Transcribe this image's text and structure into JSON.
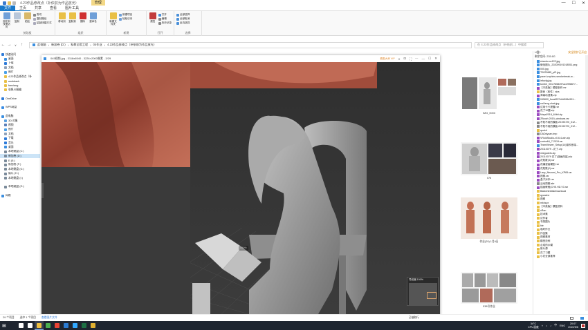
{
  "window": {
    "title": "4.23作品修改点（补依前为作品放光）",
    "manage_tab": "管理",
    "minimize_icon": "minimize-icon",
    "maximize_icon": "maximize-icon",
    "close_icon": "close-icon"
  },
  "ribbon_tabs": [
    "文件",
    "主页",
    "共享",
    "查看",
    "图片工具"
  ],
  "ribbon": {
    "clipboard": {
      "name": "剪贴板",
      "pin": "固定到快速访问",
      "copy": "复制",
      "paste": "粘贴",
      "cut": "剪切",
      "copy_path": "复制路径",
      "paste_shortcut": "粘贴快捷方式"
    },
    "organize": {
      "name": "组织",
      "move_to": "移动到",
      "copy_to": "复制到",
      "delete": "删除",
      "rename": "重命名"
    },
    "new": {
      "name": "新建",
      "new_folder": "新建文件夹",
      "new_item": "新建项目",
      "easy_access": "轻松访问"
    },
    "open": {
      "name": "打开",
      "properties": "属性",
      "open": "打开",
      "edit": "编辑",
      "history": "历史记录"
    },
    "select": {
      "name": "选择",
      "select_all": "全部选择",
      "select_none": "全部取消",
      "invert": "反向选择"
    }
  },
  "address": {
    "back_icon": "back-arrow-icon",
    "forward_icon": "forward-arrow-icon",
    "recent_icon": "chevron-down-icon",
    "up_icon": "up-arrow-icon",
    "crumbs": [
      "此电脑",
      "新加卷 (D:)",
      "私教全套工程",
      "04作业",
      "4.23作品修改点（补依前为作品放光）"
    ],
    "search_placeholder": "在 4.23作品修改点（补依前...）中搜索"
  },
  "sidebar": {
    "items": [
      {
        "label": "快速访问",
        "icon": "star-icon",
        "color": "#2f7bd8"
      },
      {
        "label": "桌面",
        "icon": "desktop-icon",
        "color": "#3b8fe0"
      },
      {
        "label": "下载",
        "icon": "download-icon",
        "color": "#2f7bd8"
      },
      {
        "label": "文档",
        "icon": "document-icon",
        "color": "#8da0b8"
      },
      {
        "label": "图片",
        "icon": "picture-icon",
        "color": "#4aa0e8"
      },
      {
        "label": "4.23作品修改点（补",
        "icon": "folder-icon",
        "color": "#e9c046"
      },
      {
        "label": "workback",
        "icon": "folder-icon",
        "color": "#e9c046"
      },
      {
        "label": "fanxiang",
        "icon": "folder-icon",
        "color": "#e9c046"
      },
      {
        "label": "张帆卡图编",
        "icon": "folder-icon",
        "color": "#e9c046"
      },
      {
        "label": "",
        "icon": "",
        "color": ""
      },
      {
        "label": "OneDrive",
        "icon": "cloud-icon",
        "color": "#2f7bd8"
      },
      {
        "label": "",
        "icon": "",
        "color": ""
      },
      {
        "label": "WPS网盘",
        "icon": "cloud-icon",
        "color": "#3a8ee6"
      },
      {
        "label": "",
        "icon": "",
        "color": ""
      },
      {
        "label": "此电脑",
        "icon": "computer-icon",
        "color": "#3b8fe0"
      },
      {
        "label": "3D 对象",
        "icon": "cube-icon",
        "color": "#5aa0e0"
      },
      {
        "label": "视频",
        "icon": "video-icon",
        "color": "#5a7fb8"
      },
      {
        "label": "图片",
        "icon": "picture-icon",
        "color": "#4aa0e8"
      },
      {
        "label": "文档",
        "icon": "document-icon",
        "color": "#8da0b8"
      },
      {
        "label": "下载",
        "icon": "download-icon",
        "color": "#2f7bd8"
      },
      {
        "label": "音乐",
        "icon": "music-icon",
        "color": "#2f7bd8"
      },
      {
        "label": "桌面",
        "icon": "desktop-icon",
        "color": "#3b8fe0"
      },
      {
        "label": "本地磁盘 (C:)",
        "icon": "drive-icon",
        "color": "#7a8a9a"
      },
      {
        "label": "新加卷 (D:)",
        "icon": "drive-icon",
        "color": "#7a8a9a",
        "selected": true
      },
      {
        "label": "E (E:)",
        "icon": "drive-icon",
        "color": "#7a8a9a"
      },
      {
        "label": "新加卷 (F:)",
        "icon": "drive-icon",
        "color": "#7a8a9a"
      },
      {
        "label": "本地磁盘 (G:)",
        "icon": "drive-icon",
        "color": "#7a8a9a"
      },
      {
        "label": "娱乐 (H:)",
        "icon": "drive-icon",
        "color": "#7a8a9a"
      },
      {
        "label": "本地磁盘 (I:)",
        "icon": "drive-icon",
        "color": "#7a8a9a"
      },
      {
        "label": "",
        "icon": "",
        "color": ""
      },
      {
        "label": "本地磁盘 (G:)",
        "icon": "drive-icon",
        "color": "#7a8a9a"
      },
      {
        "label": "",
        "icon": "",
        "color": ""
      },
      {
        "label": "网络",
        "icon": "network-icon",
        "color": "#3b8fe0"
      }
    ]
  },
  "thumbnails": [
    {
      "caption": "IMG_0003"
    },
    {
      "caption": "075"
    },
    {
      "caption": "作业(29) 1月6日"
    },
    {
      "caption": "538号作业"
    }
  ],
  "viewer": {
    "title": "045视频.jpg - 3118x6540 - 3226×2000像素 - 3/29",
    "badge": "看图大师 VIP",
    "zoom": "150%",
    "navigator_label": "导航器 150%",
    "toolbar_icons": [
      "rotate-left-icon",
      "fit-icon",
      "actual-size-icon",
      "zoom-out-icon",
      "zoom-in-icon",
      "undo-icon",
      "redo-icon",
      "prev-icon",
      "next-icon",
      "thumbs-icon",
      "crop-icon",
      "delete-icon",
      "share-icon",
      "edit-icon",
      "grid-icon",
      "more-icon"
    ],
    "ctrl_icons": [
      "menu-icon",
      "pin-icon",
      "fullscreen-icon",
      "more-icon",
      "minimize-icon",
      "maximize-icon",
      "close-icon"
    ],
    "toolbar_badge": "新"
  },
  "right_panel": {
    "header_left": "U盘1",
    "header_right": "安全防护已开启",
    "subheader": "剩余空间: 235.6G",
    "files": [
      {
        "name": "shaobu.oc122.jpg",
        "type": "img"
      },
      {
        "name": "微信图片_202009191018551.png",
        "type": "img"
      },
      {
        "name": "005.jpg",
        "type": "img"
      },
      {
        "name": "T0023885_pf2.jpg",
        "type": "img"
      },
      {
        "name": "pavel-vophins-smokebreak-w...",
        "type": "img"
      },
      {
        "name": "infocfg.jpg",
        "type": "img"
      },
      {
        "name": "tumblr_001r7658497ace998677...",
        "type": "img"
      },
      {
        "name": "【中英版】模型制作.rar",
        "type": "rar"
      },
      {
        "name": "数码（软件）aba",
        "type": "folder"
      },
      {
        "name": "海南动漫素.zip",
        "type": "rar"
      },
      {
        "name": "045600_fuoall227c0d996e591...",
        "type": "img"
      },
      {
        "name": "cal-feng-chair.jpg",
        "type": "img"
      },
      {
        "name": "试用卡卡提醒.rar",
        "type": "rar"
      },
      {
        "name": "花了10题.zip",
        "type": "rar"
      },
      {
        "name": "Maya2018_64bit.zip",
        "type": "rar"
      },
      {
        "name": "ZBrush 2019_windows.rar",
        "type": "rar"
      },
      {
        "name": "不知不用的模板.20190720_012...",
        "type": "doc"
      },
      {
        "name": "不知不用的模板.20190720_012...",
        "type": "doc"
      },
      {
        "name": "qsuluf",
        "type": "folder"
      },
      {
        "name": "DADdyuan.tmp",
        "type": "doc"
      },
      {
        "name": "VRoidStudio-v0.6.4-win.zip",
        "type": "rar"
      },
      {
        "name": "cudnn64_7-2019.rar",
        "type": "rar"
      },
      {
        "name": "TeamViewer_Setup(14)普吹依瑞...",
        "type": "img"
      },
      {
        "name": "20110079 - 花了.zip",
        "type": "rar"
      },
      {
        "name": "xbegudcfu.zip",
        "type": "rar"
      },
      {
        "name": "20110079 花了(漫画改装).zip",
        "type": "rar"
      },
      {
        "name": "花知数(3).rar",
        "type": "rar"
      },
      {
        "name": "改编漫画模型.rar",
        "type": "rar"
      },
      {
        "name": "花知数(2).rar",
        "type": "rar"
      },
      {
        "name": "Lazy_Nezumi_Pro_KP65.rar",
        "type": "rar"
      },
      {
        "name": "视频.rar",
        "type": "rar"
      },
      {
        "name": "盒子对作.rar",
        "type": "rar"
      },
      {
        "name": "活动周期.abr",
        "type": "doc"
      },
      {
        "name": "插画教程(CHS.HD.V3.rar",
        "type": "rar"
      },
      {
        "name": "BaiduNetdiskDownload",
        "type": "folder"
      },
      {
        "name": "qycache",
        "type": "folder"
      },
      {
        "name": "视频",
        "type": "folder"
      },
      {
        "name": "mkhzyz",
        "type": "folder"
      },
      {
        "name": "【中英版】模型资料",
        "type": "folder"
      },
      {
        "name": "xRan",
        "type": "folder"
      },
      {
        "name": "技术素",
        "type": "folder"
      },
      {
        "name": "试作者",
        "type": "folder"
      },
      {
        "name": "书架图片",
        "type": "folder"
      },
      {
        "name": "hle",
        "type": "folder"
      },
      {
        "name": "临时作业",
        "type": "folder"
      },
      {
        "name": "作品集",
        "type": "folder"
      },
      {
        "name": "视频素材",
        "type": "folder"
      },
      {
        "name": "模型范例",
        "type": "folder"
      },
      {
        "name": "合成的示模",
        "type": "folder"
      },
      {
        "name": "新片源",
        "type": "folder"
      },
      {
        "name": "花了习题",
        "type": "folder"
      },
      {
        "name": "小花全部推荐",
        "type": "folder"
      }
    ]
  },
  "status": {
    "count": "29 个项目",
    "selected": "选中 1 个项目",
    "view_label": "查看图片文件",
    "right_label": "已抽取行",
    "details_view_icon": "details-view-icon",
    "large_icons_view_icon": "large-icons-view-icon"
  },
  "taskbar": {
    "start_icon": "windows-start-icon",
    "apps": [
      {
        "icon": "search-icon",
        "color": "#ffffff"
      },
      {
        "icon": "task-view-icon",
        "color": "#ffffff"
      },
      {
        "icon": "file-explorer-icon",
        "color": "#f0c040",
        "active": true
      },
      {
        "icon": "browser-icon",
        "color": "#4caf50"
      },
      {
        "icon": "chrome-icon",
        "color": "#e84335"
      },
      {
        "icon": "mail-icon",
        "color": "#2b7cd3"
      },
      {
        "icon": "photoshop-icon",
        "color": "#31a8ff"
      },
      {
        "icon": "excel-icon",
        "color": "#1d7044"
      },
      {
        "icon": "viewer-icon",
        "color": "#e0b030"
      }
    ],
    "temp": "34°C",
    "cpu": "CPU温度",
    "lang": "ENG",
    "time": "20:07",
    "date": "2022/5/6",
    "notify_icon": "notification-icon",
    "tray_icons": [
      "chevron-up-icon",
      "network-icon",
      "volume-icon",
      "input-icon"
    ]
  }
}
